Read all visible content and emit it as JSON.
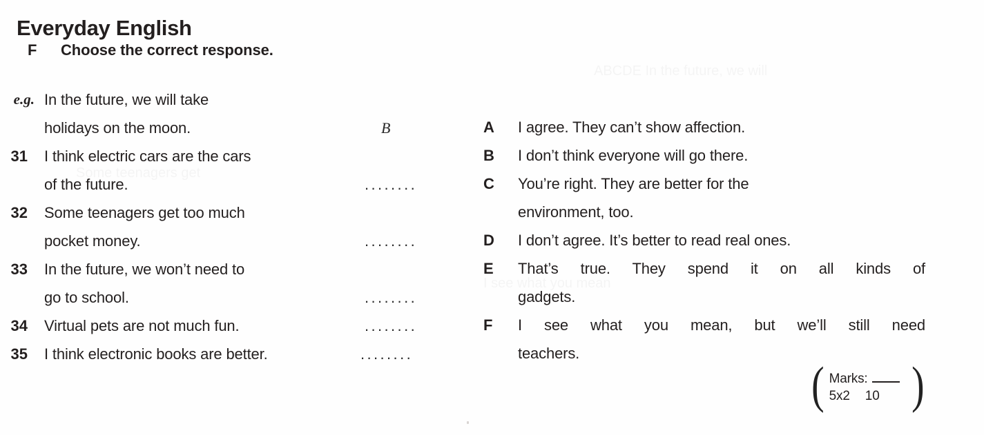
{
  "title": "Everyday English",
  "rubric": {
    "letter": "F",
    "text": "Choose the correct response."
  },
  "questions": [
    {
      "num": "e.g.",
      "lines": [
        "In the future, we will take",
        "holidays on the moon."
      ],
      "trail": "B",
      "trail_type": "answer"
    },
    {
      "num": "31",
      "lines": [
        "I think electric cars are the cars",
        "of the future."
      ],
      "trail": "........",
      "trail_type": "dots"
    },
    {
      "num": "32",
      "lines": [
        "Some teenagers get too much",
        "pocket money."
      ],
      "trail": "........",
      "trail_type": "dots"
    },
    {
      "num": "33",
      "lines": [
        "In the future, we won’t need to",
        "go to school."
      ],
      "trail": "........",
      "trail_type": "dots"
    },
    {
      "num": "34",
      "lines": [
        "Virtual pets are not much fun."
      ],
      "trail": "........",
      "trail_type": "dots"
    },
    {
      "num": "35",
      "lines": [
        "I think electronic books are better."
      ],
      "trail": "........",
      "trail_type": "dots"
    }
  ],
  "options": [
    {
      "letter": "A",
      "lines": [
        "I agree. They can’t show affection."
      ],
      "justified": false
    },
    {
      "letter": "B",
      "lines": [
        "I don’t think everyone will go there."
      ],
      "justified": false
    },
    {
      "letter": "C",
      "lines": [
        "You’re right. They are better for the",
        "environment, too."
      ],
      "justified": false
    },
    {
      "letter": "D",
      "lines": [
        "I don’t agree. It’s better to read real ones."
      ],
      "justified": false
    },
    {
      "letter": "E",
      "lines": [
        "That’s true. They spend it on all kinds of",
        "gadgets."
      ],
      "justified": true
    },
    {
      "letter": "F",
      "lines": [
        "I see what you mean, but we’ll still need",
        "teachers."
      ],
      "justified": true
    }
  ],
  "marks": {
    "label": "Marks:",
    "blank": "",
    "total": "10",
    "multiplier": "5x2",
    "open_paren": "(",
    "close_paren": ")"
  },
  "colors": {
    "ink": "#231f1f",
    "paper": "#fefefe"
  }
}
